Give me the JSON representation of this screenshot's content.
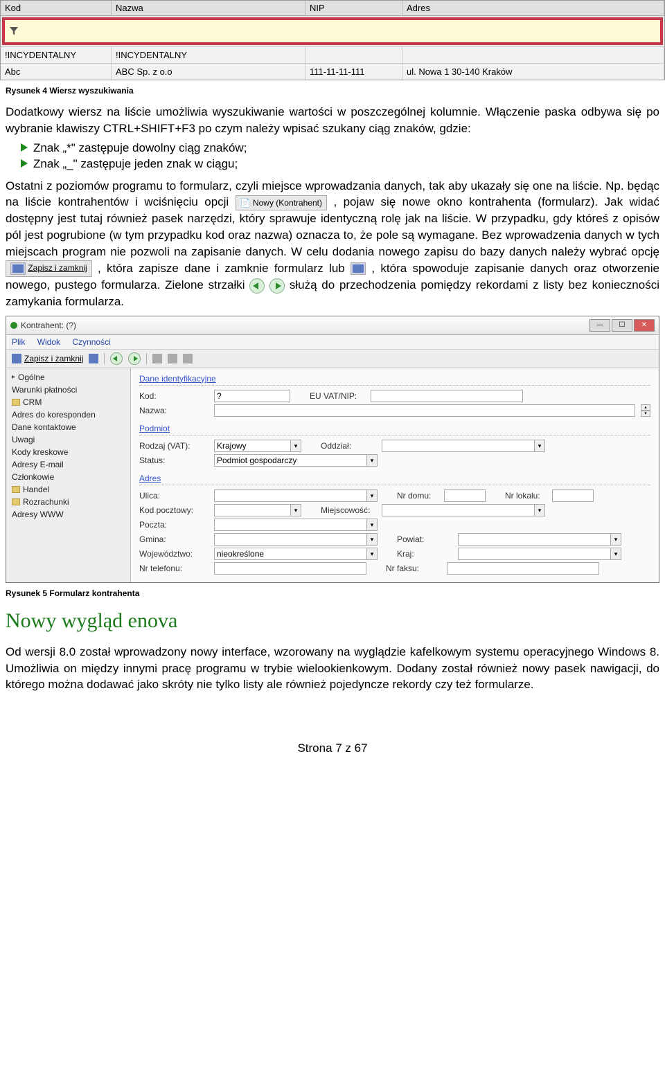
{
  "table": {
    "headers": {
      "kod": "Kod",
      "nazwa": "Nazwa",
      "nip": "NIP",
      "adres": "Adres"
    },
    "rows": [
      {
        "kod": "!INCYDENTALNY",
        "nazwa": "!INCYDENTALNY",
        "nip": "",
        "adres": ""
      },
      {
        "kod": "Abc",
        "nazwa": "ABC Sp. z o.o",
        "nip": "111-11-11-111",
        "adres": "ul. Nowa 1 30-140 Kraków"
      }
    ]
  },
  "captions": {
    "fig4": "Rysunek 4 Wiersz wyszukiwania",
    "fig5": "Rysunek 5 Formularz kontrahenta"
  },
  "text": {
    "p1": "Dodatkowy wiersz na liście umożliwia wyszukiwanie wartości w poszczególnej kolumnie. Włączenie paska odbywa się po wybranie klawiszy CTRL+SHIFT+F3 po czym należy wpisać szukany ciąg znaków, gdzie:",
    "bullets": [
      "Znak „*\" zastępuje dowolny ciąg znaków;",
      "Znak „_\" zastępuje jeden znak w ciągu;"
    ],
    "p2a": "Ostatni z poziomów programu to formularz, czyli miejsce wprowadzania danych, tak aby ukazały się one na liście. Np. będąc na liście kontrahentów i wciśnięciu opcji ",
    "inline_nowy": "Nowy (Kontrahent)",
    "p2b": ", pojaw się nowe okno kontrahenta (formularz). Jak widać dostępny jest tutaj również pasek narzędzi, który sprawuje identyczną rolę jak na liście. W przypadku, gdy któreś z opisów pól jest pogrubione (w tym przypadku kod oraz nazwa) oznacza to, że pole są wymagane. Bez wprowadzenia danych w tych miejscach program nie pozwoli na zapisanie danych. W celu dodania nowego zapisu do bazy danych należy wybrać opcję ",
    "inline_zapisz": "Zapisz i zamknij",
    "p2c": ", która zapisze dane i zamknie formularz lub ",
    "p2d": ", która spowoduje zapisanie danych oraz otworzenie nowego, pustego formularza. Zielone strzałki ",
    "p2e": " służą do przechodzenia pomiędzy rekordami z listy bez konieczności zamykania formularza."
  },
  "form_window": {
    "title": "Kontrahent: (?)",
    "menu": {
      "plik": "Plik",
      "widok": "Widok",
      "czynnosci": "Czynności"
    },
    "toolbar": {
      "zapisz": "Zapisz i zamknij"
    },
    "sidebar": [
      "Ogólne",
      "Warunki płatności",
      "CRM",
      "Adres do koresponden",
      "Dane kontaktowe",
      "Uwagi",
      "Kody kreskowe",
      "Adresy E-mail",
      "Członkowie",
      "Handel",
      "Rozrachunki",
      "Adresy WWW"
    ],
    "sections": {
      "dane": "Dane identyfikacyjne",
      "podmiot": "Podmiot",
      "adres": "Adres"
    },
    "labels": {
      "kod": "Kod:",
      "nazwa": "Nazwa:",
      "euvat": "EU VAT/NIP:",
      "rodzaj": "Rodzaj (VAT):",
      "status": "Status:",
      "oddzial": "Oddział:",
      "ulica": "Ulica:",
      "nrdomu": "Nr domu:",
      "nrlokalu": "Nr lokalu:",
      "kodpocztowy": "Kod pocztowy:",
      "miejscowosc": "Miejscowość:",
      "poczta": "Poczta:",
      "gmina": "Gmina:",
      "powiat": "Powiat:",
      "wojewodztwo": "Województwo:",
      "kraj": "Kraj:",
      "nrtelefonu": "Nr telefonu:",
      "nrfaksu": "Nr faksu:"
    },
    "values": {
      "kod": "?",
      "rodzaj": "Krajowy",
      "status": "Podmiot gospodarczy",
      "wojewodztwo": "nieokreślone"
    }
  },
  "section_title": "Nowy wygląd enova",
  "p3": "Od wersji 8.0 został wprowadzony nowy interface, wzorowany na wyglądzie kafelkowym systemu operacyjnego Windows 8. Umożliwia on między innymi pracę programu w trybie wielookienkowym. Dodany został również nowy pasek nawigacji, do którego można dodawać jako skróty nie tylko listy ale również pojedyncze rekordy czy też formularze.",
  "footer": "Strona 7 z 67"
}
